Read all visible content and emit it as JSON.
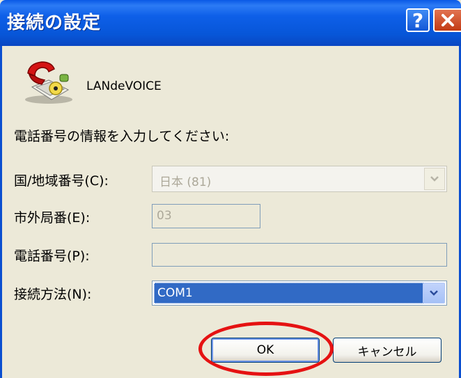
{
  "window": {
    "title": "接続の設定",
    "help_label": "?"
  },
  "app": {
    "name": "LANdeVOICE",
    "icon": "telephone-icon"
  },
  "instruction": "電話番号の情報を入力してください:",
  "fields": {
    "country": {
      "label": "国/地域番号(C):",
      "value": "日本 (81)",
      "enabled": false
    },
    "area_code": {
      "label": "市外局番(E):",
      "value": "03",
      "enabled": false
    },
    "phone_number": {
      "label": "電話番号(P):",
      "value": "",
      "enabled": false
    },
    "connection_method": {
      "label": "接続方法(N):",
      "value": "COM1",
      "enabled": true
    }
  },
  "buttons": {
    "ok": "OK",
    "cancel": "キャンセル"
  },
  "colors": {
    "titlebar": "#0a59e6",
    "window_bg": "#ece9d8",
    "selection": "#316ac5",
    "annotation_ring": "#e51212"
  }
}
